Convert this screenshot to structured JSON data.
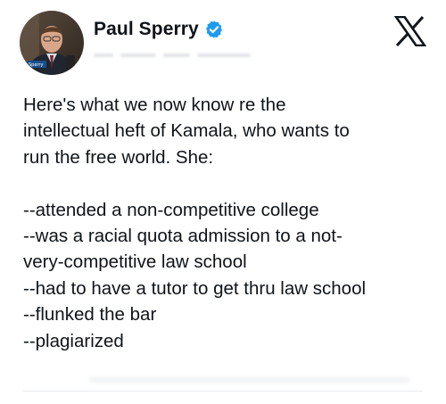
{
  "post": {
    "author": {
      "display_name": "Paul Sperry",
      "verified": true,
      "avatar_caption": "Sperry"
    },
    "platform_logo": "x-logo-icon",
    "text": "Here's what we now know re the\nintellectual heft of Kamala, who wants to\nrun the free world. She:\n\n--attended a non-competitive college\n--was a racial quota admission to a not-\nvery-competitive law school\n--had to have a tutor to get thru law school\n--flunked the bar\n--plagiarized"
  },
  "colors": {
    "text": "#0f1419",
    "verified_badge": "#1d9bf0",
    "background": "#ffffff"
  }
}
